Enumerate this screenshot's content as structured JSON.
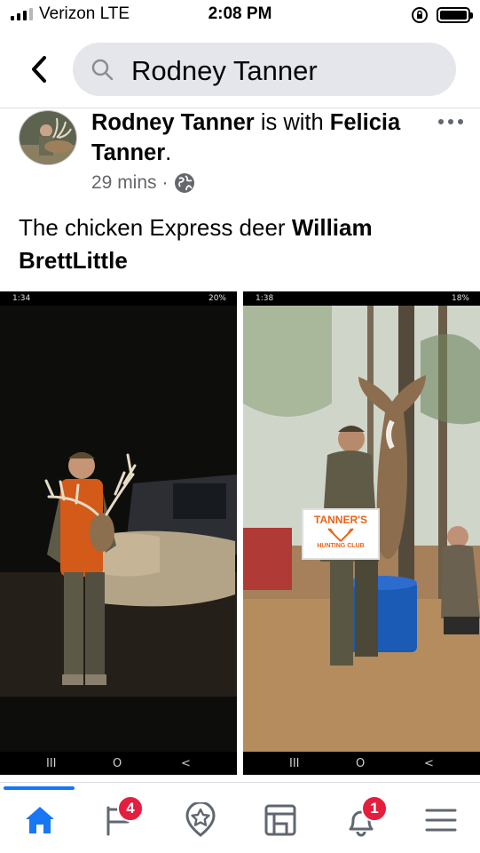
{
  "status_bar": {
    "carrier": "Verizon LTE",
    "time": "2:08 PM",
    "signal_bars_filled": 3,
    "signal_bars_total": 4,
    "icons": [
      "orientation-lock-icon",
      "battery-icon"
    ]
  },
  "search": {
    "query": "Rodney Tanner",
    "back_icon": "chevron-left-icon",
    "search_icon": "search-icon"
  },
  "post": {
    "author": "Rodney Tanner",
    "with_text": "is with",
    "tagged": "Felicia Tanner",
    "period": ".",
    "time": "29 mins",
    "separator": "·",
    "privacy_icon": "globe-icon",
    "text_plain": "The chicken Express  deer",
    "text_bold_1": "William",
    "text_bold_2": "BrettLittle",
    "photos": [
      {
        "time": "1:34",
        "battery": "20%",
        "nav": [
          "III",
          "O",
          "<"
        ]
      },
      {
        "time": "1:38",
        "battery": "18%",
        "nav": [
          "III",
          "O",
          "<"
        ]
      }
    ],
    "sign_line_1": "TANNER'S",
    "sign_line_2": "HUNTING CLUB"
  },
  "bottom_nav": {
    "items": [
      {
        "name": "home",
        "icon": "home-icon",
        "active": true
      },
      {
        "name": "feeds",
        "icon": "flag-icon",
        "badge": "4"
      },
      {
        "name": "marketplace",
        "icon": "star-badge-icon"
      },
      {
        "name": "pages",
        "icon": "pages-icon"
      },
      {
        "name": "notifications",
        "icon": "bell-icon",
        "badge": "1"
      },
      {
        "name": "menu",
        "icon": "menu-icon"
      }
    ]
  },
  "colors": {
    "accent": "#1877f2",
    "badge": "#e41e3f",
    "search_bg": "#e4e6eb",
    "meta_text": "#65676b"
  }
}
